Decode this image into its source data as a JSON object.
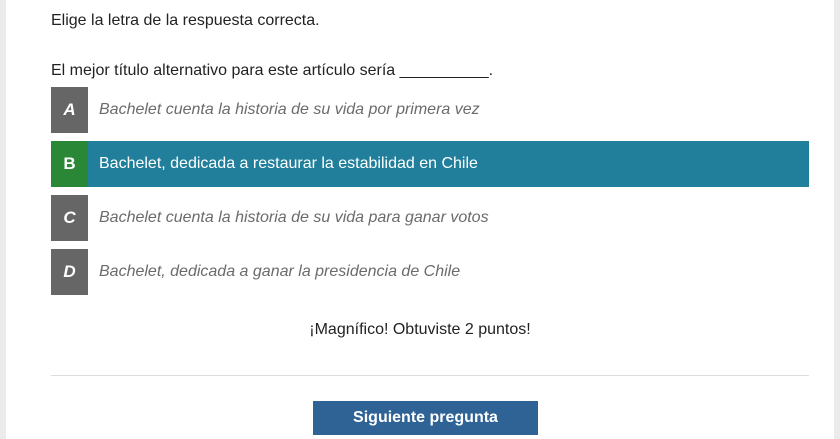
{
  "instruction": "Elige la letra de la respuesta correcta.",
  "question": "El mejor título alternativo para este artículo sería __________.",
  "options": [
    {
      "letter": "A",
      "text": "Bachelet cuenta la historia de su vida por primera vez",
      "state": "default"
    },
    {
      "letter": "B",
      "text": "Bachelet, dedicada a restaurar la estabilidad en Chile",
      "state": "selected-correct"
    },
    {
      "letter": "C",
      "text": "Bachelet cuenta la historia de su vida para ganar votos",
      "state": "default"
    },
    {
      "letter": "D",
      "text": "Bachelet, dedicada a ganar la presidencia de Chile",
      "state": "default"
    }
  ],
  "feedback": "¡Magnífico! Obtuviste 2 puntos!",
  "next_button": "Siguiente pregunta",
  "colors": {
    "selected_bg": "#217f9c",
    "correct_letter_bg": "#2a8735",
    "letter_bg": "#666666",
    "button_bg": "#2f6396"
  }
}
